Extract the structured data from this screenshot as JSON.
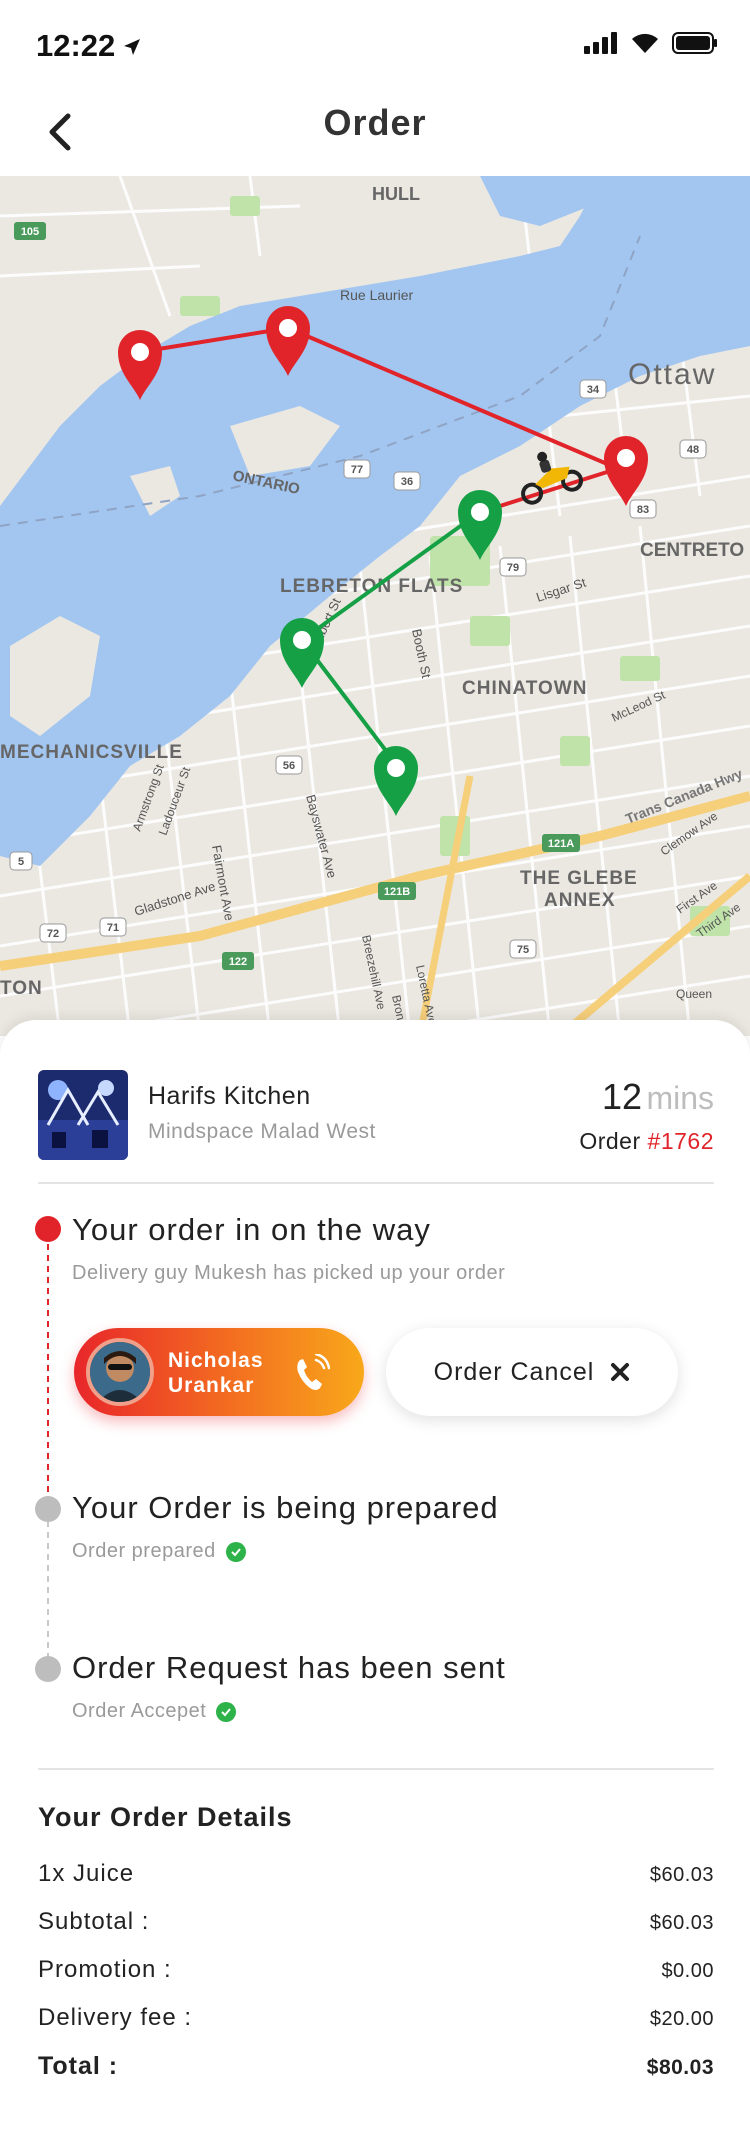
{
  "status_bar": {
    "time": "12:22"
  },
  "header": {
    "title": "Order"
  },
  "map": {
    "labels": [
      "HULL",
      "Ottaw",
      "ONTARIO",
      "CENTRETO",
      "LEBRETON FLATS",
      "CHINATOWN",
      "MECHANICSVILLE",
      "THE GLEBE",
      "ANNEX",
      "TON",
      "Trans Canada Hwy",
      "Rue Laurier",
      "Booth St",
      "Lisgar St",
      "Albert St",
      "Bayswater Ave",
      "Fairmont Ave",
      "Gladstone Ave",
      "McLeod St",
      "Clemow Ave",
      "First Ave",
      "Third Ave",
      "Queen",
      "Bronson Ave",
      "Breezehill Ave",
      "Loretta Ave",
      "Armstrong St",
      "Ladouceur St",
      "105",
      "77",
      "36",
      "34",
      "48",
      "83",
      "79",
      "121A",
      "121B",
      "122",
      "75",
      "56",
      "72",
      "5",
      "71"
    ]
  },
  "restaurant": {
    "name": "Harifs Kitchen",
    "address": "Mindspace Malad West"
  },
  "eta": {
    "value": "12",
    "unit": "mins"
  },
  "order": {
    "label": "Order",
    "id": "#1762"
  },
  "timeline": [
    {
      "title": "Your order in on the way",
      "subtitle": "Delivery guy Mukesh has picked up your order",
      "status": "active"
    },
    {
      "title": "Your Order is being prepared",
      "subtitle": "Order prepared",
      "status": "done"
    },
    {
      "title": "Order Request has been sent",
      "subtitle": "Order Accepet",
      "status": "done"
    }
  ],
  "driver": {
    "first_name": "Nicholas",
    "last_name": "Urankar"
  },
  "cancel": {
    "label": "Order Cancel"
  },
  "details": {
    "title": "Your Order Details",
    "rows": [
      {
        "label": "1x Juice",
        "value": "$60.03"
      },
      {
        "label": "Subtotal :",
        "value": "$60.03"
      },
      {
        "label": "Promotion :",
        "value": "$0.00"
      },
      {
        "label": "Delivery fee :",
        "value": "$20.00"
      },
      {
        "label": "Total :",
        "value": "$80.03"
      }
    ]
  },
  "colors": {
    "accent_red": "#e0242a",
    "route_green": "#15a046",
    "check_green": "#2db34a",
    "orange": "#f8a81a"
  },
  "icons": [
    "location-arrow-icon",
    "signal-icon",
    "wifi-icon",
    "battery-icon",
    "back-chevron-icon",
    "map-pin-icon",
    "motorbike-icon",
    "phone-icon",
    "close-icon",
    "check-icon"
  ]
}
